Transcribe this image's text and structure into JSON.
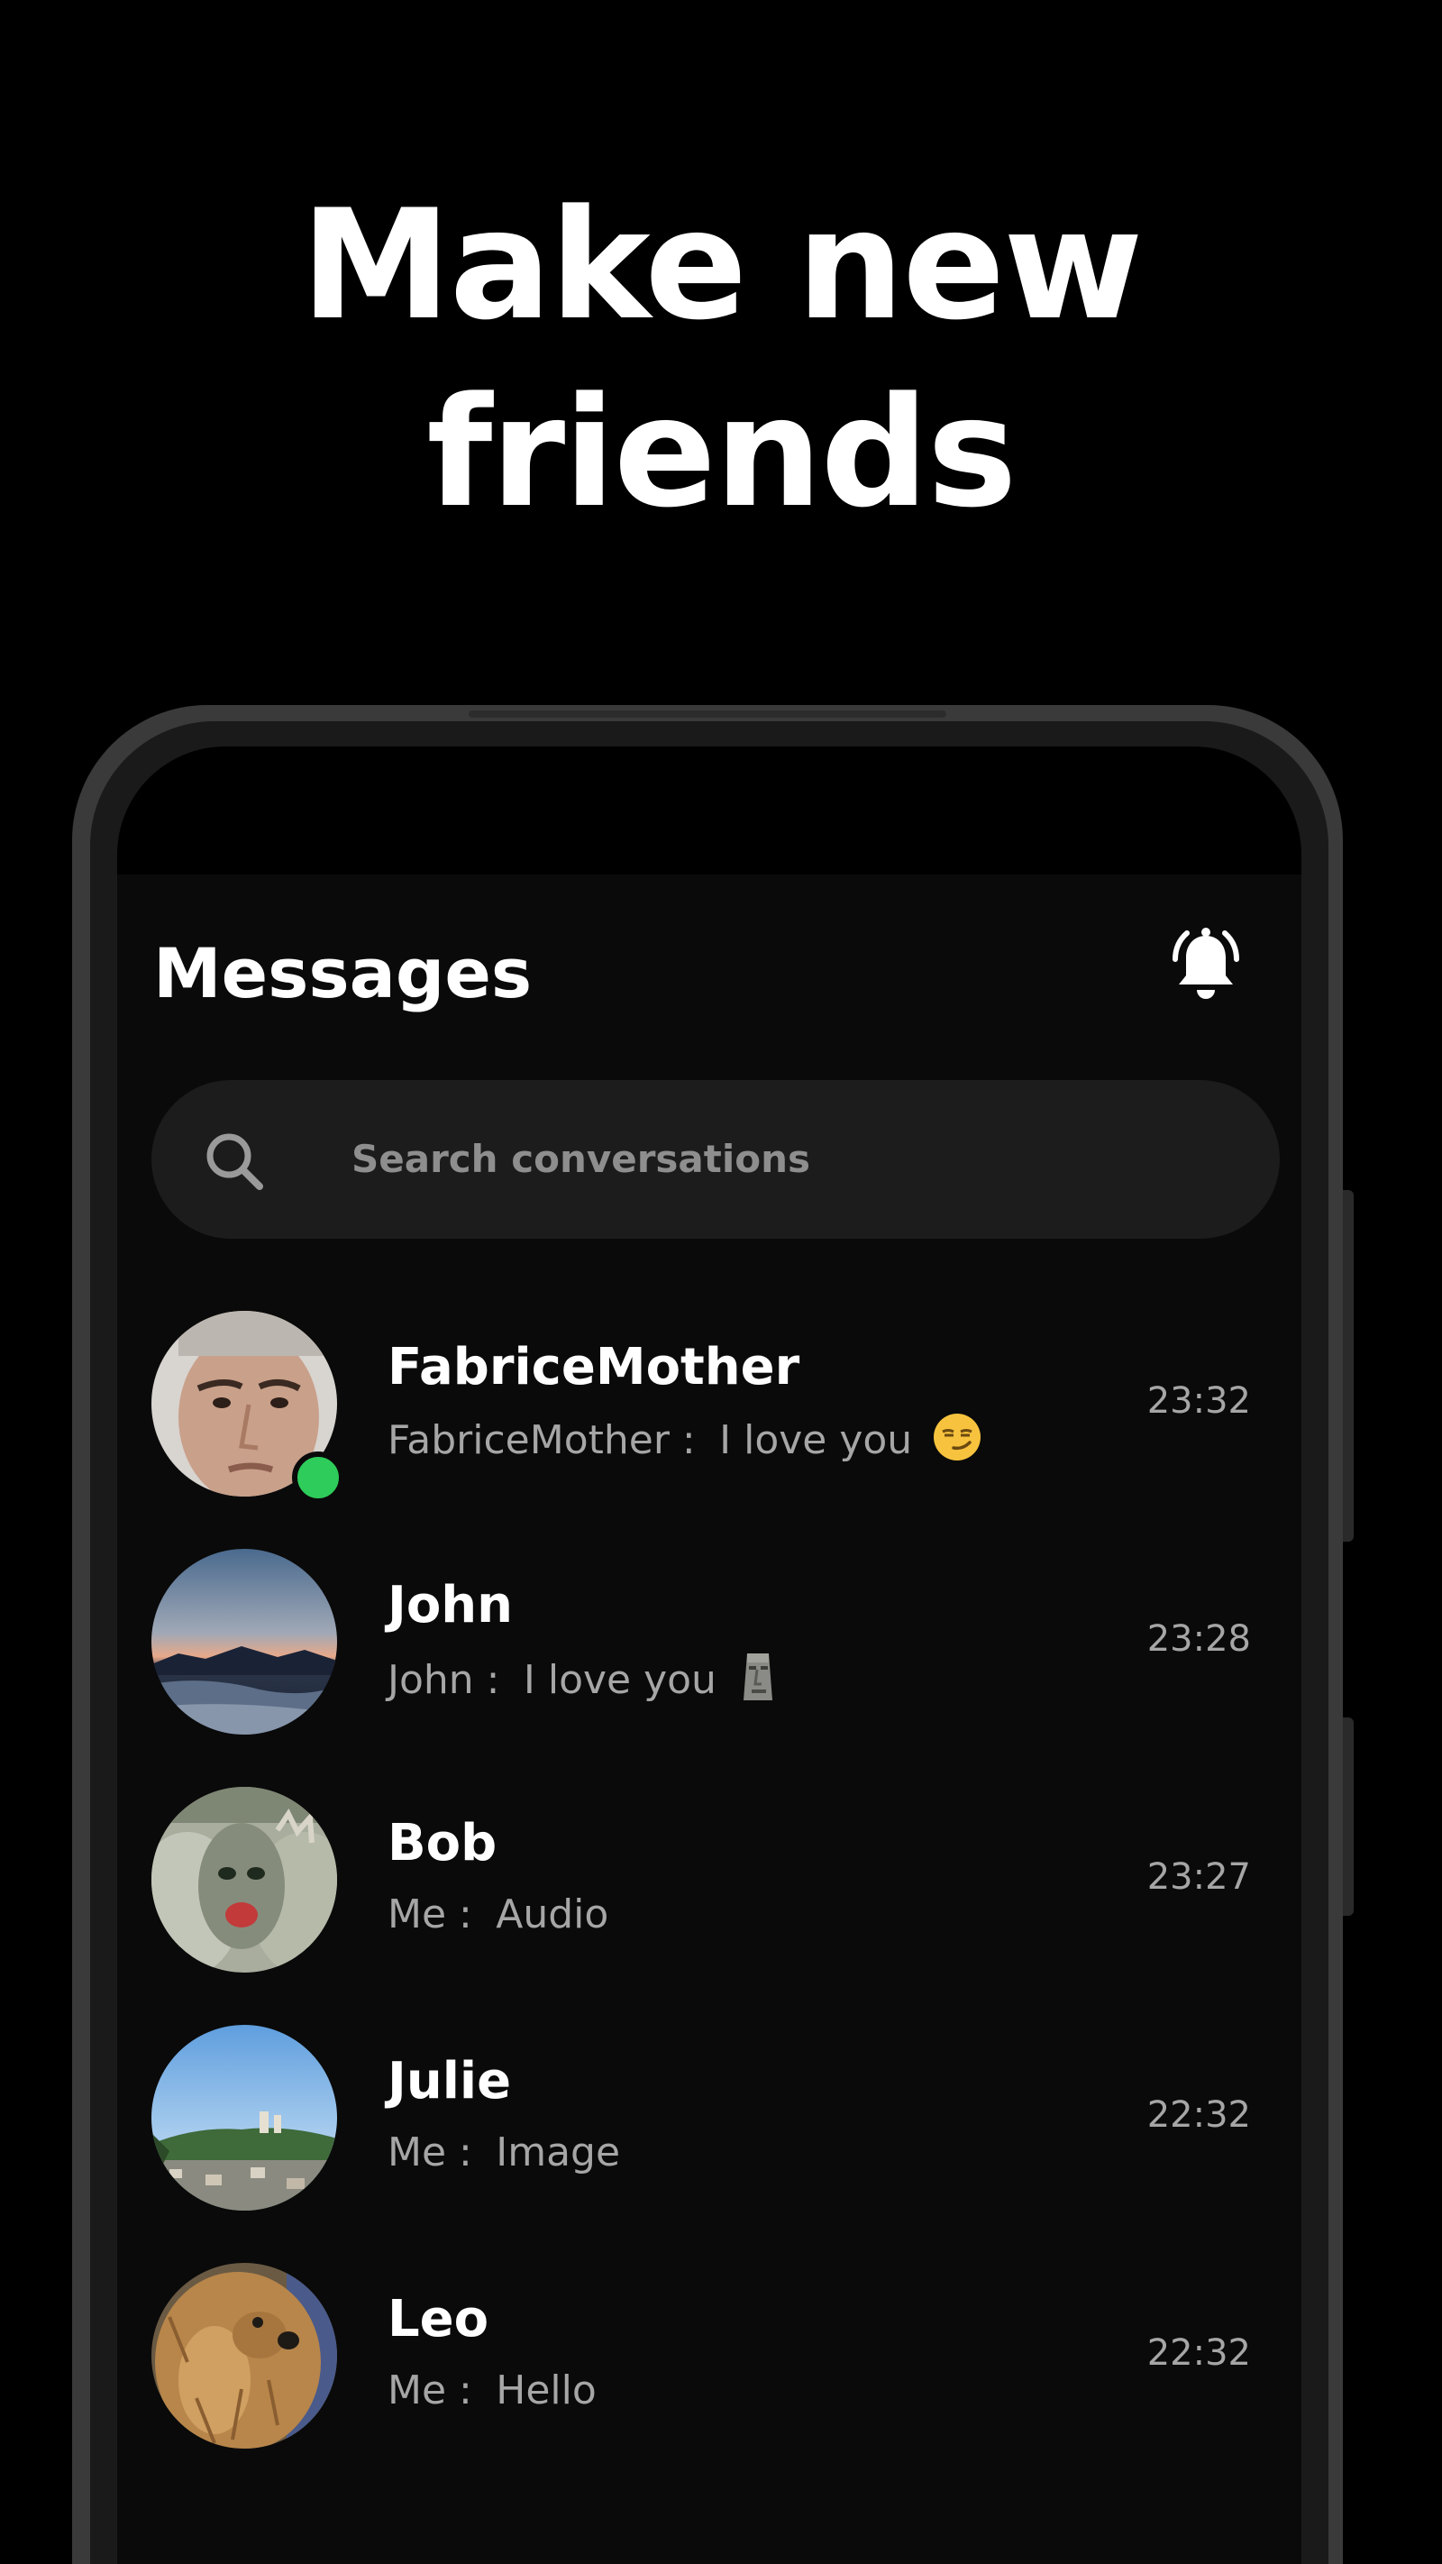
{
  "headline": {
    "line1": "Make new",
    "line2": "friends"
  },
  "app": {
    "title": "Messages",
    "bell_icon": "bell-icon",
    "search": {
      "placeholder": "Search conversations",
      "icon": "search-icon"
    }
  },
  "conversations": [
    {
      "name": "FabriceMother",
      "sender": "FabriceMother :",
      "message": "I love you",
      "emoji": "smirking-face",
      "time": "23:32",
      "online": true
    },
    {
      "name": "John",
      "sender": "John :",
      "message": "I love you",
      "emoji": "moai",
      "time": "23:28",
      "online": false
    },
    {
      "name": "Bob",
      "sender": "Me :",
      "message": "Audio",
      "time": "23:27",
      "online": false
    },
    {
      "name": "Julie",
      "sender": "Me :",
      "message": "Image",
      "time": "22:32",
      "online": false
    },
    {
      "name": "Leo",
      "sender": "Me :",
      "message": "Hello",
      "time": "22:32",
      "online": false
    }
  ],
  "colors": {
    "background": "#000000",
    "app_background": "#0a0a0a",
    "search_background": "#1c1c1c",
    "secondary_text": "#a6a6a6",
    "online_indicator": "#2ecc5a"
  }
}
